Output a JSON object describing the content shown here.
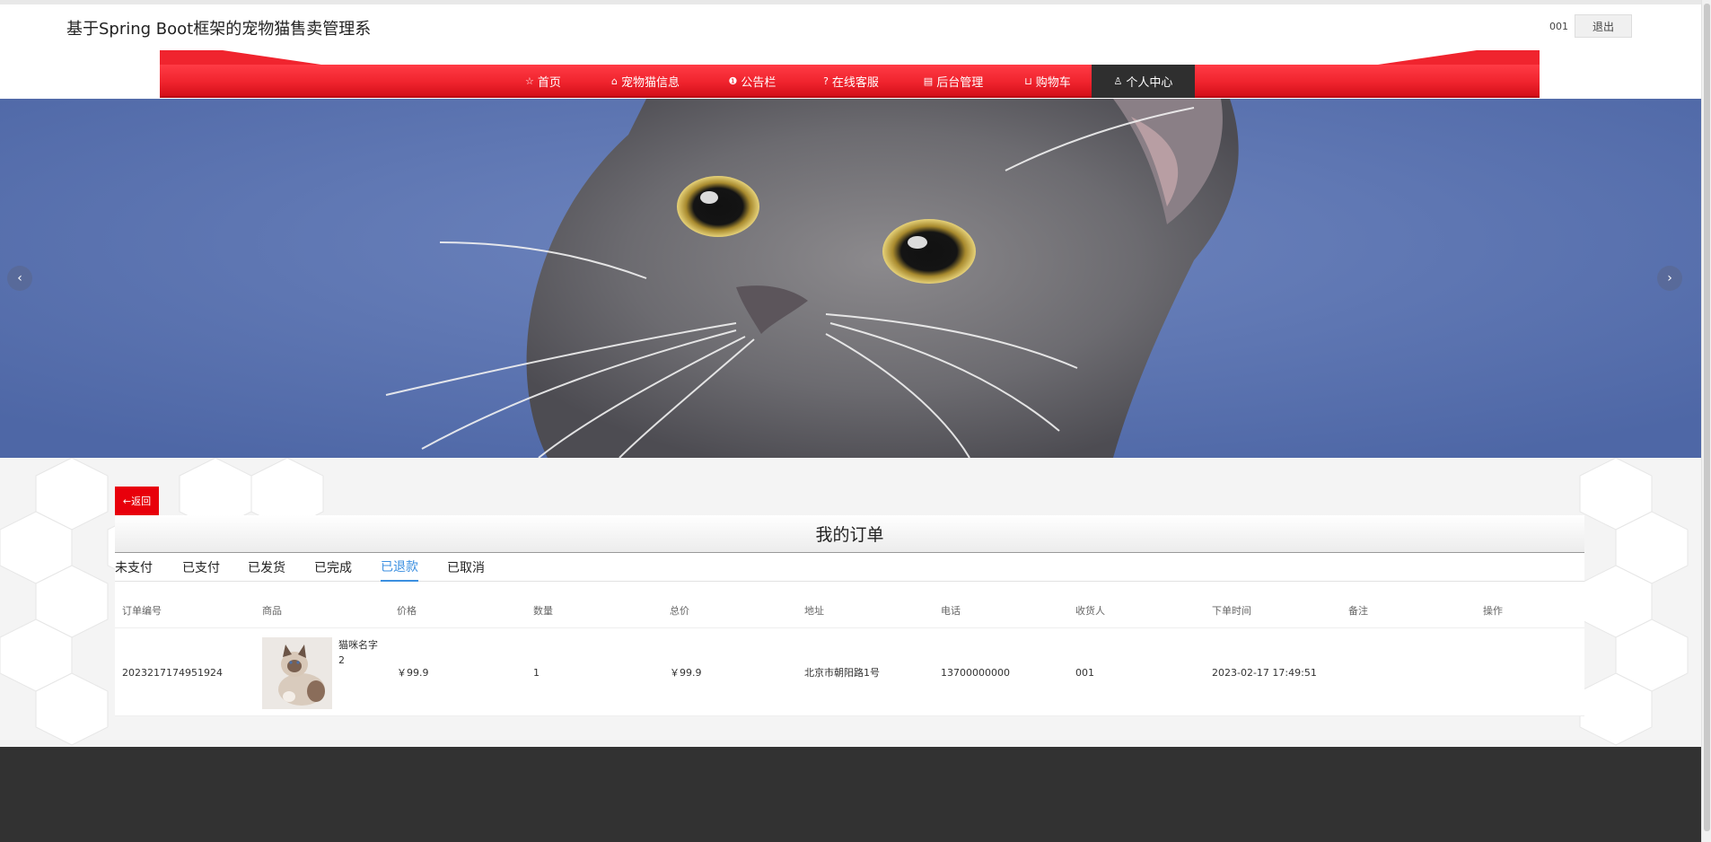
{
  "header": {
    "title": "基于Spring Boot框架的宠物猫售卖管理系",
    "username": "001",
    "logout_label": "退出"
  },
  "nav": {
    "items": [
      {
        "label": "首页",
        "icon": "☆"
      },
      {
        "label": "宠物猫信息",
        "icon": "⌂"
      },
      {
        "label": "公告栏",
        "icon": "❶"
      },
      {
        "label": "在线客服",
        "icon": "?"
      },
      {
        "label": "后台管理",
        "icon": "▤"
      },
      {
        "label": "购物车",
        "icon": "⊔"
      },
      {
        "label": "个人中心",
        "icon": "♙",
        "active": true
      }
    ]
  },
  "banner": {
    "prev_icon": "‹",
    "next_icon": "›"
  },
  "back_label": "←返回",
  "orders": {
    "title": "我的订单",
    "tabs": [
      "未支付",
      "已支付",
      "已发货",
      "已完成",
      "已退款",
      "已取消"
    ],
    "active_tab": "已退款",
    "columns": [
      "订单编号",
      "商品",
      "价格",
      "数量",
      "总价",
      "地址",
      "电话",
      "收货人",
      "下单时间",
      "备注",
      "操作"
    ],
    "rows": [
      {
        "order_no": "2023217174951924",
        "product_name": "猫咪名字",
        "product_qty": "2",
        "price": "￥99.9",
        "quantity": "1",
        "total": "￥99.9",
        "address": "北京市朝阳路1号",
        "phone": "13700000000",
        "receiver": "001",
        "time": "2023-02-17 17:49:51",
        "remark": "",
        "action": ""
      }
    ]
  },
  "colors": {
    "nav_red": "#f0242e",
    "active_nav": "#2f2f2f",
    "back_button": "#e8000b",
    "active_tab": "#3b8fe0",
    "banner_blue": "#5a76b0",
    "footer": "#323232"
  }
}
